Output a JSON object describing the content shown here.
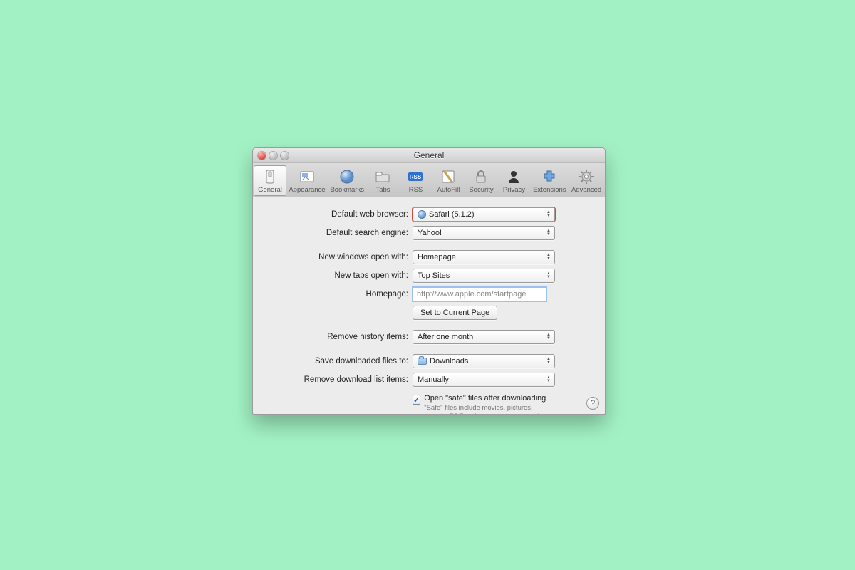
{
  "window": {
    "title": "General"
  },
  "toolbar": {
    "items": [
      {
        "label": "General"
      },
      {
        "label": "Appearance"
      },
      {
        "label": "Bookmarks"
      },
      {
        "label": "Tabs"
      },
      {
        "label": "RSS"
      },
      {
        "label": "AutoFill"
      },
      {
        "label": "Security"
      },
      {
        "label": "Privacy"
      },
      {
        "label": "Extensions"
      },
      {
        "label": "Advanced"
      }
    ]
  },
  "labels": {
    "default_browser": "Default web browser:",
    "default_search": "Default search engine:",
    "new_windows": "New windows open with:",
    "new_tabs": "New tabs open with:",
    "homepage": "Homepage:",
    "set_current": "Set to Current Page",
    "remove_history": "Remove history items:",
    "save_downloads": "Save downloaded files to:",
    "remove_downloads": "Remove download list items:",
    "safe_label": "Open \"safe\" files after downloading",
    "safe_hint": "\"Safe\" files include movies, pictures, sounds, PDF and text documents, and archives."
  },
  "values": {
    "default_browser": "Safari (5.1.2)",
    "default_search": "Yahoo!",
    "new_windows": "Homepage",
    "new_tabs": "Top Sites",
    "homepage": "http://www.apple.com/startpage",
    "remove_history": "After one month",
    "save_downloads": "Downloads",
    "remove_downloads": "Manually",
    "safe_checked": true
  },
  "help": "?"
}
